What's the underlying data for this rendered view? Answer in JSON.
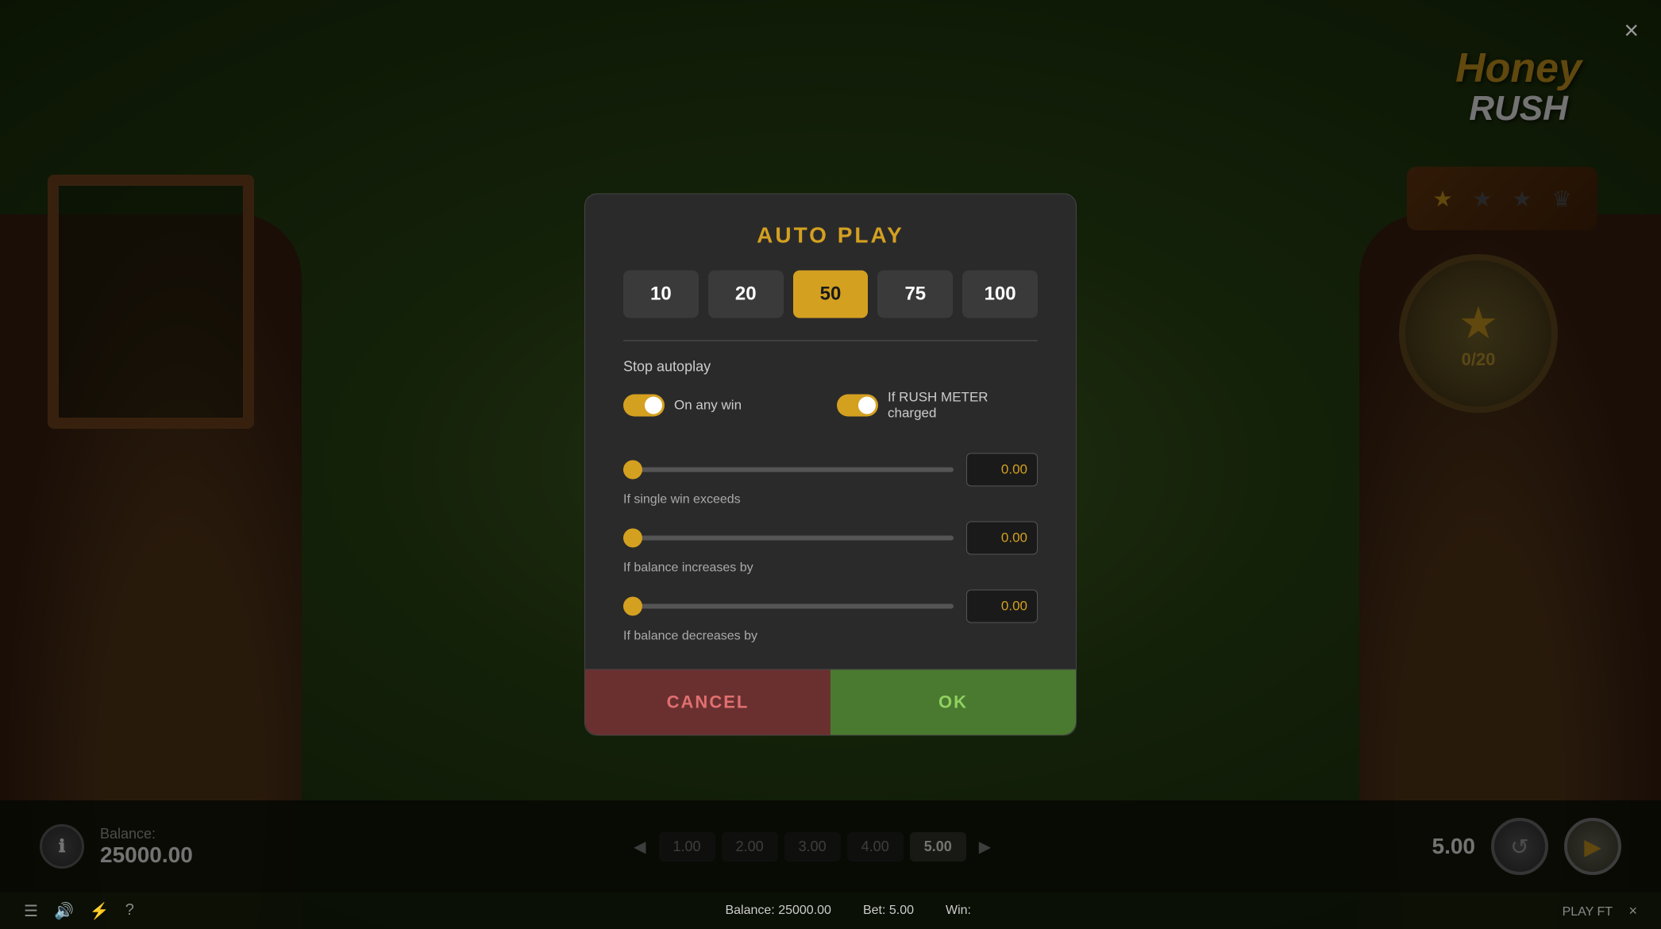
{
  "app": {
    "title": "Honey Rush",
    "close_label": "×"
  },
  "modal": {
    "title": "AUTO PLAY",
    "spin_options": [
      {
        "value": "10",
        "active": false
      },
      {
        "value": "20",
        "active": false
      },
      {
        "value": "50",
        "active": true
      },
      {
        "value": "75",
        "active": false
      },
      {
        "value": "100",
        "active": false
      }
    ],
    "stop_autoplay_label": "Stop autoplay",
    "toggle_on_any_win": "On any win",
    "toggle_rush_meter": "If RUSH METER charged",
    "sliders": [
      {
        "label": "If single win exceeds",
        "value": "0.00"
      },
      {
        "label": "If balance increases by",
        "value": "0.00"
      },
      {
        "label": "If balance decreases by",
        "value": "0.00"
      }
    ],
    "cancel_label": "CANCEL",
    "ok_label": "OK"
  },
  "bottom_bar": {
    "balance_label": "Balance:",
    "balance_value": "25000.00",
    "bet_label": "5.00",
    "bet_options": [
      "1.00",
      "2.00",
      "3.00",
      "4.00",
      "5.00"
    ]
  },
  "status_bar": {
    "balance_text": "Balance: 25000.00",
    "bet_text": "Bet: 5.00",
    "win_text": "Win:",
    "play_text": "PLAY FT"
  },
  "star_badge": {
    "count": "0/20"
  },
  "icons": {
    "menu": "☰",
    "sound": "🔊",
    "bolt": "⚡",
    "help": "?",
    "info": "ℹ",
    "star": "★",
    "crown": "♛",
    "refresh": "↺",
    "play": "▶"
  }
}
